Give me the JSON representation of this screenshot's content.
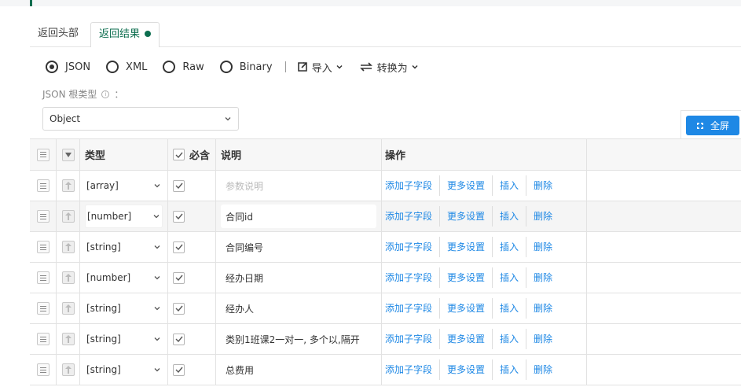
{
  "tabs": [
    {
      "label": "返回头部",
      "active": false
    },
    {
      "label": "返回结果",
      "active": true
    }
  ],
  "colors": {
    "accent": "#0d6e4f",
    "link": "#1e88e5",
    "fullscreen_bg": "#1e88e5"
  },
  "format": {
    "options": [
      {
        "label": "JSON",
        "selected": true
      },
      {
        "label": "XML",
        "selected": false
      },
      {
        "label": "Raw",
        "selected": false
      },
      {
        "label": "Binary",
        "selected": false
      }
    ],
    "import_label": "导入",
    "convert_label": "转换为"
  },
  "root_type": {
    "label": "JSON 根类型",
    "colon": "：",
    "value": "Object"
  },
  "fullscreen_label": "全屏",
  "table": {
    "headers": {
      "type": "类型",
      "required": "必含",
      "desc": "说明",
      "actions": "操作"
    },
    "action_labels": {
      "add_child": "添加子字段",
      "more": "更多设置",
      "insert": "插入",
      "delete": "删除"
    },
    "rows": [
      {
        "type": "[array]",
        "required": true,
        "desc": "参数说明",
        "placeholder": true
      },
      {
        "type": "[number]",
        "required": true,
        "desc": "合同id",
        "placeholder": false
      },
      {
        "type": "[string]",
        "required": true,
        "desc": "合同编号",
        "placeholder": false
      },
      {
        "type": "[number]",
        "required": true,
        "desc": "经办日期",
        "placeholder": false
      },
      {
        "type": "[string]",
        "required": true,
        "desc": "经办人",
        "placeholder": false
      },
      {
        "type": "[string]",
        "required": true,
        "desc": "类别1班课2一对一, 多个以,隔开",
        "placeholder": false
      },
      {
        "type": "[string]",
        "required": true,
        "desc": "总费用",
        "placeholder": false
      }
    ]
  }
}
